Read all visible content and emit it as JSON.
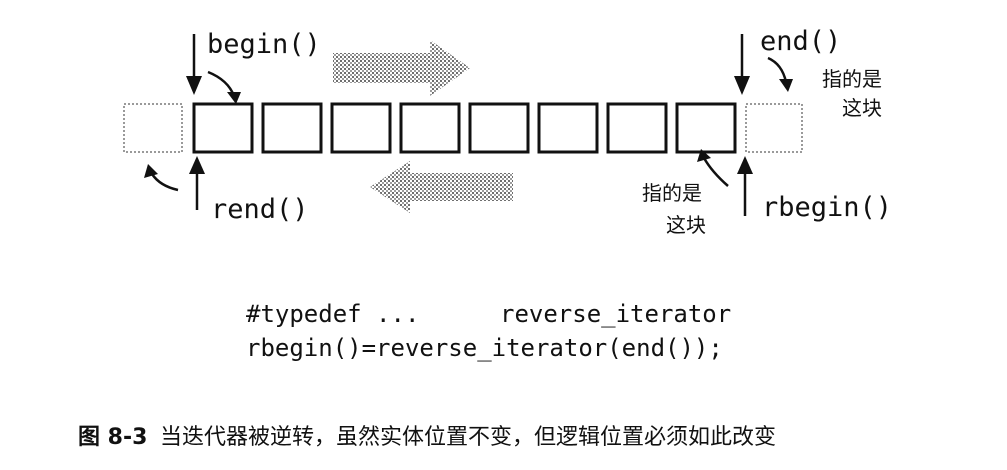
{
  "labels": {
    "begin": "begin()",
    "end": "end()",
    "rend": "rend()",
    "rbegin": "rbegin()"
  },
  "notes": {
    "end_note_line1": "指的是",
    "end_note_line2": "这块",
    "rbegin_note_line1": "指的是",
    "rbegin_note_line2": "这块"
  },
  "code": {
    "line1_a": "#typedef ...",
    "line1_b": "reverse_iterator",
    "line2": "rbegin()=reverse_iterator(end());"
  },
  "caption": {
    "figure_number": "图 8-3",
    "text": "当迭代器被逆转，虽然实体位置不变，但逻辑位置必须如此改变"
  },
  "cells": {
    "count": 8
  },
  "colors": {
    "ink": "#111111",
    "shaded_arrow": "#8c8c8c",
    "ghost_box": "#9a9a9a"
  }
}
